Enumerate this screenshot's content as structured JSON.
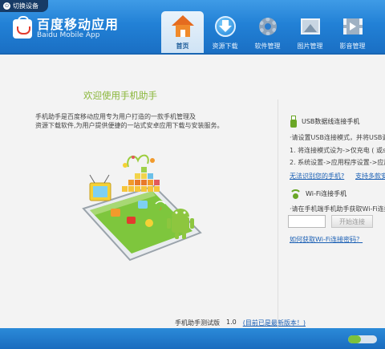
{
  "header": {
    "switch_device": "切换设备",
    "logo_cn": "百度移动应用",
    "logo_en": "Baidu Mobile App",
    "nav": [
      {
        "label": "首页",
        "icon": "home-icon"
      },
      {
        "label": "资源下载",
        "icon": "download-icon"
      },
      {
        "label": "软件管理",
        "icon": "gear-icon"
      },
      {
        "label": "图片管理",
        "icon": "picture-icon"
      },
      {
        "label": "影音管理",
        "icon": "video-icon"
      }
    ],
    "active_nav": "首页"
  },
  "main": {
    "welcome": "欢迎使用手机助手",
    "desc_line1": "手机助手是百度移动应用专为用户打造的一款手机管理及",
    "desc_line2": "资源下载软件,为用户提供便捷的一站式安卓应用下载与安装服务。",
    "version_label": "手机助手测试版",
    "version_number": "1.0",
    "latest_link": "(目前已是最新版本！)"
  },
  "usb": {
    "title": "USB数据线连接手机",
    "line1": "·请设置USB连接模式，并将USB调试",
    "line2": "1. 将连接模式设为->仅充电 ( 或sync",
    "line3": "2. 系统设置->应用程序设置->应用开",
    "link_fail": "无法识别您的手机?",
    "link_support": "支持多款安卓手"
  },
  "wifi": {
    "title": "Wi-Fi连接手机",
    "line1": "·请在手机端手机助手获取Wi-Fi连接验",
    "input_value": "",
    "connect_button": "开始连接",
    "link_code": "如何获取Wi-Fi连接密码？"
  },
  "status": {
    "toggle_progress": 0.45
  },
  "colors": {
    "header_blue": "#2281d6",
    "welcome_green": "#8ab63a",
    "link_blue": "#1a5fb4",
    "android_green": "#7cc13c"
  }
}
